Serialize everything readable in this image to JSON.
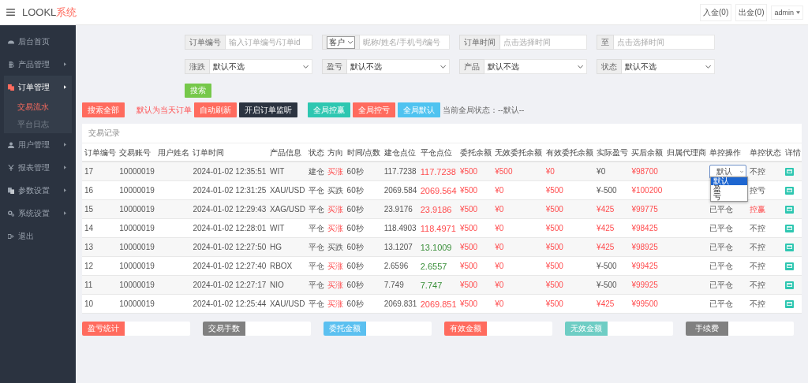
{
  "header": {
    "logo": {
      "text": "LOOKL",
      "accent": "系统"
    },
    "links": [
      "入金(0)",
      "出金(0)"
    ],
    "user": "admin"
  },
  "sidebar": {
    "items": [
      {
        "label": "后台首页",
        "has_children": false,
        "expanded": false
      },
      {
        "label": "产品管理",
        "has_children": true,
        "expanded": false
      },
      {
        "label": "订单管理",
        "has_children": true,
        "expanded": true,
        "children": [
          {
            "label": "交易流水",
            "selected": true
          },
          {
            "label": "平台日志",
            "selected": false
          }
        ]
      },
      {
        "label": "用户管理",
        "has_children": true,
        "expanded": false
      },
      {
        "label": "报表管理",
        "has_children": true,
        "expanded": false
      },
      {
        "label": "参数设置",
        "has_children": true,
        "expanded": false
      },
      {
        "label": "系统设置",
        "has_children": true,
        "expanded": false
      },
      {
        "label": "退出",
        "has_children": false,
        "expanded": false
      }
    ]
  },
  "filters": [
    {
      "kind": "input",
      "label": "订单编号",
      "placeholder": "输入订单编号/订单id"
    },
    {
      "kind": "select-input",
      "select": "客户",
      "placeholder": "昵称/姓名/手机号/编号"
    },
    {
      "kind": "input",
      "label": "订单时间",
      "placeholder": "点击选择时间"
    },
    {
      "kind": "input",
      "label": "至",
      "placeholder": "点击选择时间"
    },
    {
      "kind": "select",
      "label": "涨跌",
      "value": "默认不选"
    },
    {
      "kind": "select",
      "label": "盈亏",
      "value": "默认不选"
    },
    {
      "kind": "select",
      "label": "产品",
      "value": "默认不选"
    },
    {
      "kind": "select",
      "label": "状态",
      "value": "默认不选"
    }
  ],
  "search_button": "搜索",
  "actions": [
    {
      "kind": "button",
      "label": "搜索全部",
      "color": "#ff6b5e"
    },
    {
      "kind": "note",
      "label": "默认为当天订单"
    },
    {
      "kind": "button",
      "label": "自动刷新",
      "color": "#ff6b5e"
    },
    {
      "kind": "button",
      "label": "开启订单监听",
      "color": "#2b3340"
    },
    {
      "kind": "button",
      "label": "全局控赢",
      "color": "#2ec7b1"
    },
    {
      "kind": "button",
      "label": "全局控亏",
      "color": "#ff6b5e"
    },
    {
      "kind": "button",
      "label": "全局默认",
      "color": "#4fc3f0"
    },
    {
      "kind": "status",
      "label": "当前全局状态：--默认--"
    }
  ],
  "table": {
    "title": "交易记录",
    "columns": [
      "订单编号",
      "交易账号",
      "用户姓名",
      "订单时间",
      "产品信息",
      "状态",
      "方向",
      "时间/点数",
      "建仓点位",
      "平仓点位",
      "委托余额",
      "无效委托余额",
      "有效委托余额",
      "实际盈亏",
      "买后余额",
      "归属代理商",
      "单控操作",
      "单控状态",
      "详情"
    ],
    "rows": [
      {
        "id": "17",
        "account": "10000019",
        "time": "2024-01-02 12:35:51",
        "product": "WIT",
        "status": "建仓",
        "direction": "买涨",
        "direction_up": true,
        "period": "60秒",
        "open": "117.7238",
        "close": "117.7238",
        "close_up": true,
        "entrust": "¥500",
        "invalid": "¥500",
        "valid": "¥0",
        "profit": "¥0",
        "profit_positive": false,
        "balance": "¥98700",
        "op": {
          "kind": "select",
          "value": "默认",
          "open": true,
          "options": [
            {
              "label": "默认",
              "selected": true
            },
            {
              "label": "盈",
              "selected": false
            },
            {
              "label": "亏",
              "selected": false
            }
          ]
        },
        "control": "不控",
        "control_highlight": false
      },
      {
        "id": "16",
        "account": "10000019",
        "time": "2024-01-02 12:31:25",
        "product": "XAU/USD",
        "status": "平仓",
        "direction": "买跌",
        "direction_up": false,
        "period": "60秒",
        "open": "2069.584",
        "close": "2069.564",
        "close_up": true,
        "entrust": "¥500",
        "invalid": "¥0",
        "valid": "¥500",
        "profit": "¥-500",
        "profit_positive": false,
        "balance": "¥100200",
        "control": "控亏",
        "control_highlight": false
      },
      {
        "id": "15",
        "account": "10000019",
        "time": "2024-01-02 12:29:43",
        "product": "XAG/USD",
        "status": "平仓",
        "direction": "买涨",
        "direction_up": true,
        "period": "60秒",
        "open": "23.9176",
        "close": "23.9186",
        "close_up": true,
        "entrust": "¥500",
        "invalid": "¥0",
        "valid": "¥500",
        "profit": "¥425",
        "profit_positive": true,
        "balance": "¥99775",
        "op": {
          "kind": "text",
          "value": "已平仓"
        },
        "control": "控赢",
        "control_highlight": true
      },
      {
        "id": "14",
        "account": "10000019",
        "time": "2024-01-02 12:28:01",
        "product": "WIT",
        "status": "平仓",
        "direction": "买涨",
        "direction_up": true,
        "period": "60秒",
        "open": "118.4903",
        "close": "118.4971",
        "close_up": true,
        "entrust": "¥500",
        "invalid": "¥0",
        "valid": "¥500",
        "profit": "¥425",
        "profit_positive": true,
        "balance": "¥98425",
        "op": {
          "kind": "text",
          "value": "已平仓"
        },
        "control": "不控",
        "control_highlight": false
      },
      {
        "id": "13",
        "account": "10000019",
        "time": "2024-01-02 12:27:50",
        "product": "HG",
        "status": "平仓",
        "direction": "买跌",
        "direction_up": false,
        "period": "60秒",
        "open": "13.1207",
        "close": "13.1009",
        "close_up": false,
        "entrust": "¥500",
        "invalid": "¥0",
        "valid": "¥500",
        "profit": "¥425",
        "profit_positive": true,
        "balance": "¥98925",
        "op": {
          "kind": "text",
          "value": "已平仓"
        },
        "control": "不控",
        "control_highlight": false
      },
      {
        "id": "12",
        "account": "10000019",
        "time": "2024-01-02 12:27:40",
        "product": "RBOX",
        "status": "平仓",
        "direction": "买涨",
        "direction_up": true,
        "period": "60秒",
        "open": "2.6596",
        "close": "2.6557",
        "close_up": false,
        "entrust": "¥500",
        "invalid": "¥0",
        "valid": "¥500",
        "profit": "¥-500",
        "profit_positive": false,
        "balance": "¥99425",
        "op": {
          "kind": "text",
          "value": "已平仓"
        },
        "control": "不控",
        "control_highlight": false
      },
      {
        "id": "11",
        "account": "10000019",
        "time": "2024-01-02 12:27:17",
        "product": "NIO",
        "status": "平仓",
        "direction": "买涨",
        "direction_up": true,
        "period": "60秒",
        "open": "7.749",
        "close": "7.747",
        "close_up": false,
        "entrust": "¥500",
        "invalid": "¥0",
        "valid": "¥500",
        "profit": "¥-500",
        "profit_positive": false,
        "balance": "¥99925",
        "op": {
          "kind": "text",
          "value": "已平仓"
        },
        "control": "不控",
        "control_highlight": false
      },
      {
        "id": "10",
        "account": "10000019",
        "time": "2024-01-02 12:25:44",
        "product": "XAU/USD",
        "status": "平仓",
        "direction": "买涨",
        "direction_up": true,
        "period": "60秒",
        "open": "2069.831",
        "close": "2069.851",
        "close_up": true,
        "entrust": "¥500",
        "invalid": "¥0",
        "valid": "¥500",
        "profit": "¥425",
        "profit_positive": true,
        "balance": "¥99500",
        "op": {
          "kind": "text",
          "value": "已平仓"
        },
        "control": "不控",
        "control_highlight": false
      }
    ]
  },
  "stats": [
    {
      "label": "盈亏统计",
      "color": "#ff6b5e"
    },
    {
      "label": "交易手数",
      "color": "#808080"
    },
    {
      "label": "委托金额",
      "color": "#5bc0f0"
    },
    {
      "label": "有效金额",
      "color": "#ff6b5e"
    },
    {
      "label": "无效金额",
      "color": "#6ecdc4"
    },
    {
      "label": "手续费",
      "color": "#808080"
    }
  ]
}
